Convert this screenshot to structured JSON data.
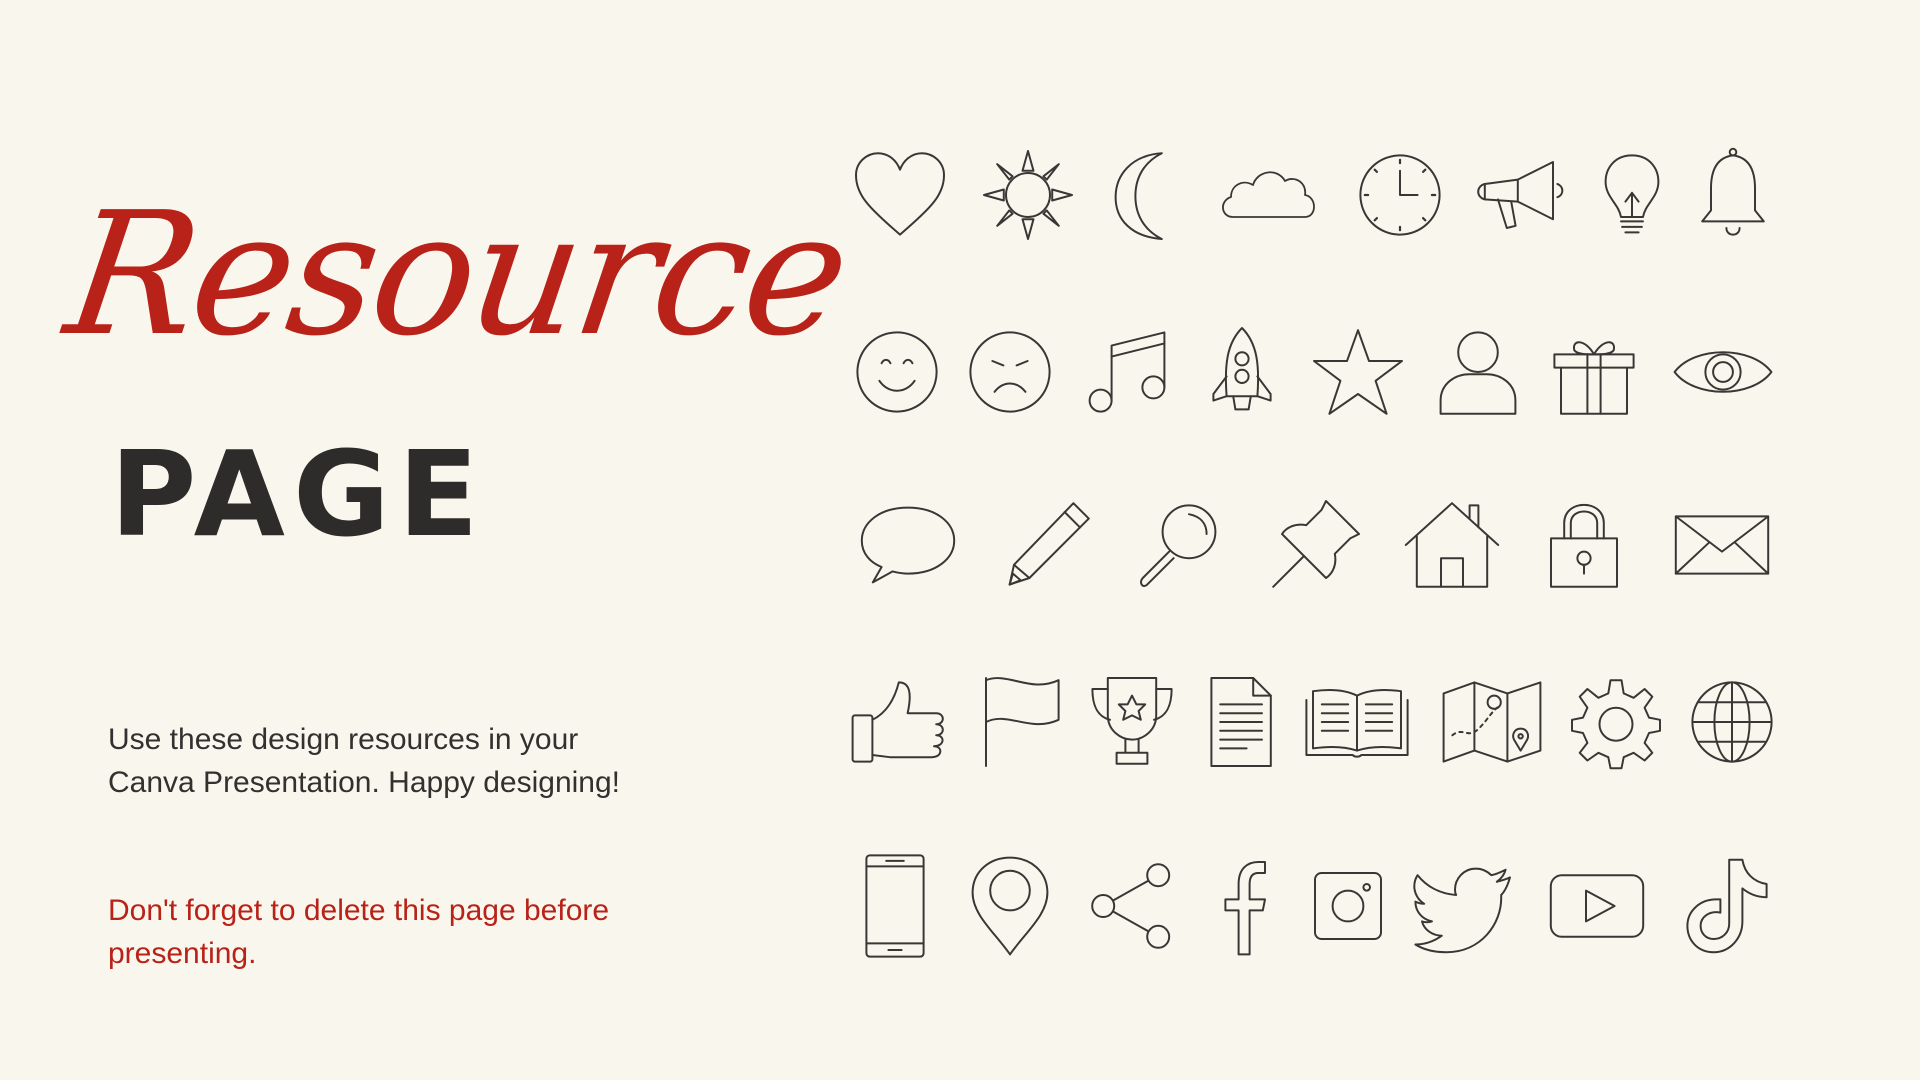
{
  "title": {
    "script": "Resource",
    "block": "PAGE"
  },
  "description": "Use these design resources in your Canva Presentation. Happy designing!",
  "note": "Don't forget to delete this page before presenting.",
  "colors": {
    "background": "#f9f6ed",
    "accent": "#b82218",
    "dark": "#2e2b2b",
    "icon_stroke": "#3a3636"
  },
  "icons": [
    [
      "heart-icon",
      "sun-icon",
      "moon-icon",
      "cloud-icon",
      "clock-icon",
      "megaphone-icon",
      "lightbulb-icon",
      "bell-icon"
    ],
    [
      "smile-icon",
      "sad-face-icon",
      "music-note-icon",
      "rocket-icon",
      "star-icon",
      "user-icon",
      "gift-icon",
      "eye-icon"
    ],
    [
      "speech-bubble-icon",
      "pencil-icon",
      "magnifier-icon",
      "pushpin-icon",
      "house-icon",
      "lock-icon",
      "envelope-icon"
    ],
    [
      "thumbs-up-icon",
      "flag-icon",
      "trophy-icon",
      "document-icon",
      "open-book-icon",
      "map-icon",
      "gear-icon",
      "globe-icon"
    ],
    [
      "smartphone-icon",
      "location-pin-icon",
      "share-icon",
      "facebook-icon",
      "instagram-icon",
      "twitter-icon",
      "youtube-icon",
      "tiktok-icon"
    ]
  ]
}
